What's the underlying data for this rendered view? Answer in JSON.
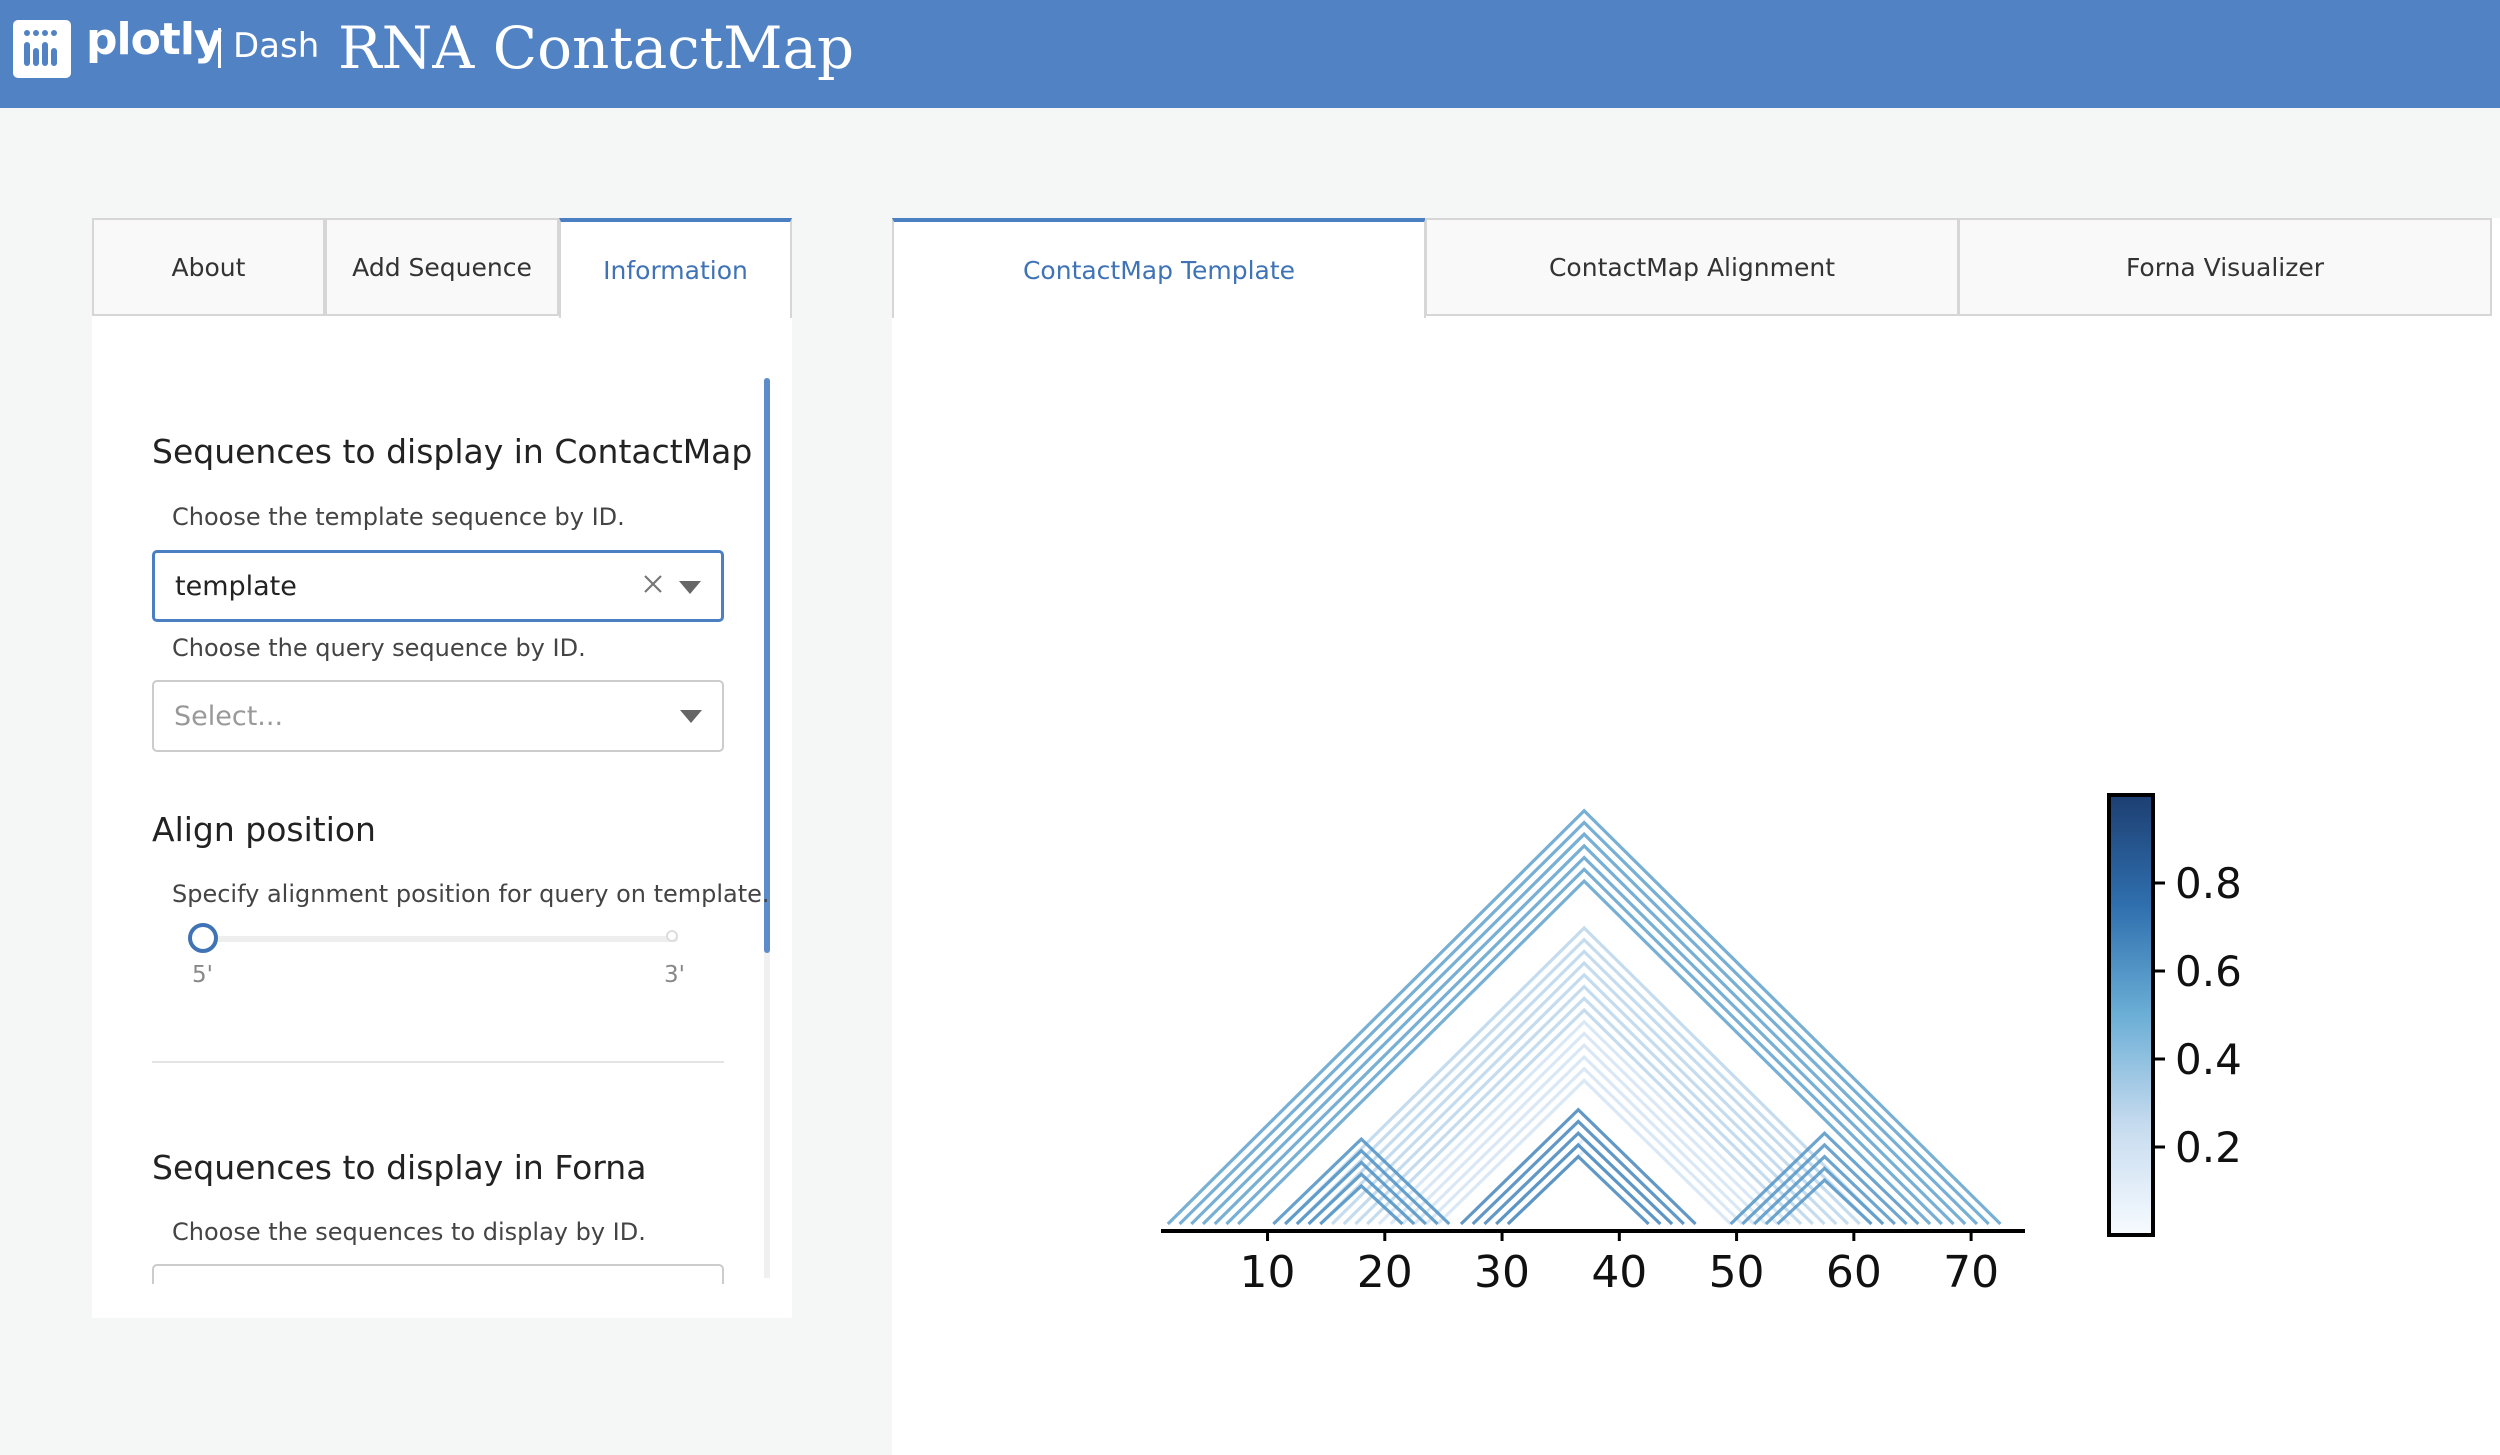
{
  "header": {
    "brand": "plotly",
    "brand_product": "Dash",
    "title": "RNA ContactMap"
  },
  "left_tabs": [
    {
      "label": "About",
      "active": false
    },
    {
      "label": "Add Sequence",
      "active": false
    },
    {
      "label": "Information",
      "active": true
    }
  ],
  "contactmap_section": {
    "heading": "Sequences to display in ContactMap",
    "template_label": "Choose the template sequence by ID.",
    "template_value": "template",
    "query_label": "Choose the query sequence by ID.",
    "query_placeholder": "Select..."
  },
  "align_section": {
    "heading": "Align position",
    "description": "Specify alignment position for query on template.",
    "slider_value": 0,
    "mark_start": "5'",
    "mark_end": "3'"
  },
  "forna_section": {
    "heading": "Sequences to display in Forna",
    "label": "Choose the sequences to display by ID."
  },
  "right_tabs": [
    {
      "label": "ContactMap Template",
      "active": true
    },
    {
      "label": "ContactMap Alignment",
      "active": false
    },
    {
      "label": "Forna Visualizer",
      "active": false
    }
  ],
  "colors": {
    "header_bg": "#5082c4",
    "accent": "#3f73b6",
    "cmap_low": "#f7fbff",
    "cmap_high": "#1d3f72"
  },
  "chart_data": {
    "type": "heatmap",
    "subtype": "triangular-contact-map",
    "xlim": [
      1,
      74
    ],
    "x_ticks": [
      10,
      20,
      30,
      40,
      50,
      60,
      70
    ],
    "colorbar_ticks": [
      0.2,
      0.4,
      0.6,
      0.8
    ],
    "colorbar_range": [
      0.0,
      1.0
    ],
    "colormap": "Blues",
    "helices": [
      {
        "i": 2,
        "j": 72,
        "pairs": 7,
        "value": 0.55
      },
      {
        "i": 12,
        "j": 62,
        "pairs": 8,
        "value": 0.28
      },
      {
        "i": 20,
        "j": 54,
        "pairs": 6,
        "value": 0.18
      },
      {
        "i": 30,
        "j": 44,
        "pairs": 2,
        "value": 0.12
      },
      {
        "i": 11,
        "j": 25,
        "pairs": 5,
        "value": 0.62
      },
      {
        "i": 27,
        "j": 46,
        "pairs": 5,
        "value": 0.66
      },
      {
        "i": 50,
        "j": 65,
        "pairs": 5,
        "value": 0.6
      }
    ]
  }
}
